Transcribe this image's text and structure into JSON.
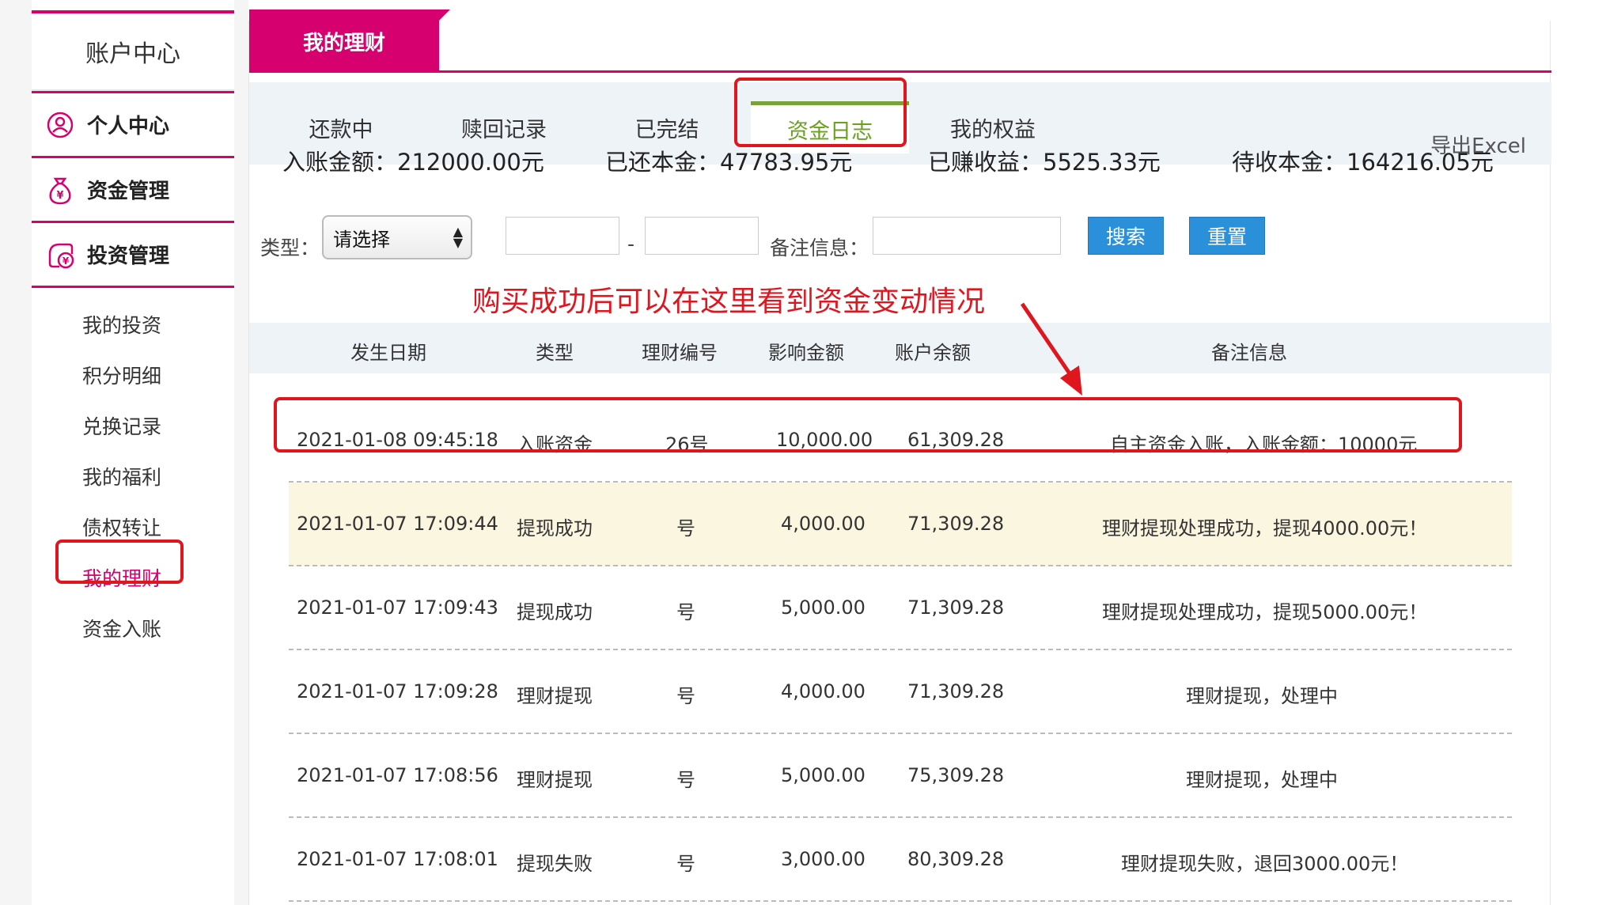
{
  "sidebar": {
    "title": "账户中心",
    "groups": [
      {
        "label": "个人中心",
        "icon": "user-circle-icon"
      },
      {
        "label": "资金管理",
        "icon": "money-bag-icon"
      },
      {
        "label": "投资管理",
        "icon": "investment-icon"
      }
    ],
    "sub_items": [
      "我的投资",
      "积分明细",
      "兑换记录",
      "我的福利",
      "债权转让",
      "我的理财",
      "资金入账"
    ],
    "active_sub": "我的理财",
    "accent_color": "#d6006f"
  },
  "main": {
    "title_tab": "我的理财",
    "tabs": [
      "还款中",
      "赎回记录",
      "已完结",
      "资金日志",
      "我的权益"
    ],
    "active_tab": "资金日志",
    "export_label": "导出Excel",
    "summary": {
      "deposit": "入账金额：212000.00元",
      "repaid_principal": "已还本金：47783.95元",
      "earned": "已赚收益：5525.33元",
      "pending_principal": "待收本金：164216.05元"
    },
    "filters": {
      "type_label": "类型：",
      "type_select": "请选择",
      "date_separator": "-",
      "remark_label": "备注信息：",
      "search_button": "搜索",
      "reset_button": "重置"
    },
    "annotation": "购买成功后可以在这里看到资金变动情况",
    "table": {
      "headers": [
        "发生日期",
        "类型",
        "理财编号",
        "影响金额",
        "账户余额",
        "备注信息"
      ],
      "rows": [
        [
          "2021-01-08 09:45:18",
          "入账资金",
          "26号",
          "10,000.00",
          "61,309.28",
          "自主资金入账，入账金额：10000元"
        ],
        [
          "2021-01-07 17:09:44",
          "提现成功",
          "号",
          "4,000.00",
          "71,309.28",
          "理财提现处理成功，提现4000.00元！"
        ],
        [
          "2021-01-07 17:09:43",
          "提现成功",
          "号",
          "5,000.00",
          "71,309.28",
          "理财提现处理成功，提现5000.00元！"
        ],
        [
          "2021-01-07 17:09:28",
          "理财提现",
          "号",
          "4,000.00",
          "71,309.28",
          "理财提现，处理中"
        ],
        [
          "2021-01-07 17:08:56",
          "理财提现",
          "号",
          "5,000.00",
          "75,309.28",
          "理财提现，处理中"
        ],
        [
          "2021-01-07 17:08:01",
          "提现失败",
          "号",
          "3,000.00",
          "80,309.28",
          "理财提现失败，退回3000.00元！"
        ]
      ]
    }
  },
  "colors": {
    "accent": "#d6006f",
    "active_tab": "#6aa11d",
    "annotation": "#e0161f",
    "button": "#2a90da"
  }
}
